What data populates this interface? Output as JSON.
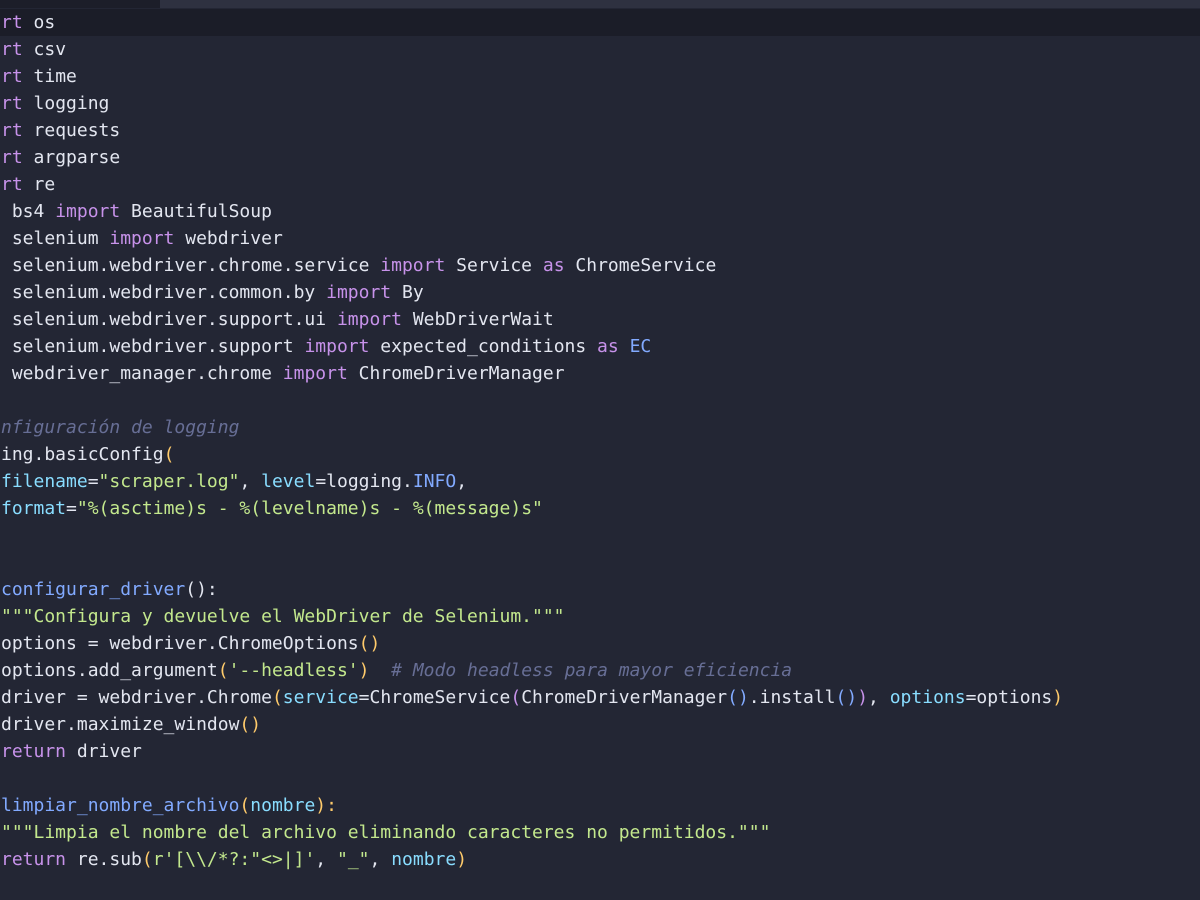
{
  "editor": {
    "colors": {
      "background": "#232634",
      "current_line": "#1b1d28",
      "keyword": "#c792ea",
      "identifier": "#e3e6f0",
      "function": "#82aaff",
      "string": "#c3e88d",
      "comment": "#676e95",
      "parameter": "#89ddff",
      "bracket": "#ffcb6b"
    },
    "lines": [
      {
        "tokens": [
          {
            "t": "rt",
            "c": "kw"
          },
          {
            "t": " os",
            "c": "var"
          }
        ]
      },
      {
        "tokens": [
          {
            "t": "rt",
            "c": "kw"
          },
          {
            "t": " csv",
            "c": "var"
          }
        ]
      },
      {
        "tokens": [
          {
            "t": "rt",
            "c": "kw"
          },
          {
            "t": " time",
            "c": "var"
          }
        ]
      },
      {
        "tokens": [
          {
            "t": "rt",
            "c": "kw"
          },
          {
            "t": " logging",
            "c": "var"
          }
        ]
      },
      {
        "tokens": [
          {
            "t": "rt",
            "c": "kw"
          },
          {
            "t": " requests",
            "c": "var"
          }
        ]
      },
      {
        "tokens": [
          {
            "t": "rt",
            "c": "kw"
          },
          {
            "t": " argparse",
            "c": "var"
          }
        ]
      },
      {
        "tokens": [
          {
            "t": "rt",
            "c": "kw"
          },
          {
            "t": " re",
            "c": "var"
          }
        ]
      },
      {
        "tokens": [
          {
            "t": " bs4 ",
            "c": "var"
          },
          {
            "t": "import",
            "c": "kw"
          },
          {
            "t": " BeautifulSoup",
            "c": "var"
          }
        ]
      },
      {
        "tokens": [
          {
            "t": " selenium ",
            "c": "var"
          },
          {
            "t": "import",
            "c": "kw"
          },
          {
            "t": " webdriver",
            "c": "var"
          }
        ]
      },
      {
        "tokens": [
          {
            "t": " selenium.webdriver.chrome.service ",
            "c": "var"
          },
          {
            "t": "import",
            "c": "kw"
          },
          {
            "t": " Service ",
            "c": "var"
          },
          {
            "t": "as",
            "c": "kw"
          },
          {
            "t": " ChromeService",
            "c": "var"
          }
        ]
      },
      {
        "tokens": [
          {
            "t": " selenium.webdriver.common.by ",
            "c": "var"
          },
          {
            "t": "import",
            "c": "kw"
          },
          {
            "t": " By",
            "c": "var"
          }
        ]
      },
      {
        "tokens": [
          {
            "t": " selenium.webdriver.support.ui ",
            "c": "var"
          },
          {
            "t": "import",
            "c": "kw"
          },
          {
            "t": " WebDriverWait",
            "c": "var"
          }
        ]
      },
      {
        "tokens": [
          {
            "t": " selenium.webdriver.support ",
            "c": "var"
          },
          {
            "t": "import",
            "c": "kw"
          },
          {
            "t": " expected_conditions ",
            "c": "var"
          },
          {
            "t": "as",
            "c": "kw"
          },
          {
            "t": " EC",
            "c": "fn"
          }
        ]
      },
      {
        "tokens": [
          {
            "t": " webdriver_manager.chrome ",
            "c": "var"
          },
          {
            "t": "import",
            "c": "kw"
          },
          {
            "t": " ChromeDriverManager",
            "c": "var"
          }
        ]
      },
      {
        "tokens": []
      },
      {
        "tokens": [
          {
            "t": "nfiguración de logging",
            "c": "cmt"
          }
        ]
      },
      {
        "tokens": [
          {
            "t": "ing.basicConfig",
            "c": "var"
          },
          {
            "t": "(",
            "c": "brk"
          }
        ]
      },
      {
        "tokens": [
          {
            "t": "filename",
            "c": "par"
          },
          {
            "t": "=",
            "c": "op"
          },
          {
            "t": "\"scraper.log\"",
            "c": "str"
          },
          {
            "t": ", ",
            "c": "sym"
          },
          {
            "t": "level",
            "c": "par"
          },
          {
            "t": "=",
            "c": "op"
          },
          {
            "t": "logging.",
            "c": "var"
          },
          {
            "t": "INFO",
            "c": "fn"
          },
          {
            "t": ",",
            "c": "sym"
          }
        ]
      },
      {
        "tokens": [
          {
            "t": "format",
            "c": "par"
          },
          {
            "t": "=",
            "c": "op"
          },
          {
            "t": "\"%(asctime)s - %(levelname)s - %(message)s\"",
            "c": "str"
          }
        ]
      },
      {
        "tokens": []
      },
      {
        "tokens": []
      },
      {
        "tokens": [
          {
            "t": "configurar_driver",
            "c": "fn"
          },
          {
            "t": "():",
            "c": "sym"
          }
        ]
      },
      {
        "tokens": [
          {
            "t": "\"\"\"Configura y devuelve el WebDriver de Selenium.\"\"\"",
            "c": "str"
          }
        ]
      },
      {
        "tokens": [
          {
            "t": "options = webdriver.ChromeOptions",
            "c": "var"
          },
          {
            "t": "()",
            "c": "brk"
          }
        ]
      },
      {
        "tokens": [
          {
            "t": "options.add_argument",
            "c": "var"
          },
          {
            "t": "(",
            "c": "brk"
          },
          {
            "t": "'--headless'",
            "c": "str"
          },
          {
            "t": ")",
            "c": "brk"
          },
          {
            "t": "  ",
            "c": "var"
          },
          {
            "t": "# Modo headless para mayor eficiencia",
            "c": "cmt"
          }
        ]
      },
      {
        "tokens": [
          {
            "t": "driver = webdriver.Chrome",
            "c": "var"
          },
          {
            "t": "(",
            "c": "brk"
          },
          {
            "t": "service",
            "c": "par"
          },
          {
            "t": "=ChromeService",
            "c": "var"
          },
          {
            "t": "(",
            "c": "brk2"
          },
          {
            "t": "ChromeDriverManager",
            "c": "var"
          },
          {
            "t": "()",
            "c": "brk3"
          },
          {
            "t": ".install",
            "c": "var"
          },
          {
            "t": "()",
            "c": "brk3"
          },
          {
            "t": ")",
            "c": "brk2"
          },
          {
            "t": ", ",
            "c": "sym"
          },
          {
            "t": "options",
            "c": "par"
          },
          {
            "t": "=options",
            "c": "var"
          },
          {
            "t": ")",
            "c": "brk"
          }
        ]
      },
      {
        "tokens": [
          {
            "t": "driver.maximize_window",
            "c": "var"
          },
          {
            "t": "()",
            "c": "brk"
          }
        ]
      },
      {
        "tokens": [
          {
            "t": "return",
            "c": "kw"
          },
          {
            "t": " driver",
            "c": "var"
          }
        ]
      },
      {
        "tokens": []
      },
      {
        "tokens": [
          {
            "t": "limpiar_nombre_archivo",
            "c": "fn"
          },
          {
            "t": "(",
            "c": "brk"
          },
          {
            "t": "nombre",
            "c": "par"
          },
          {
            "t": "):",
            "c": "brk"
          }
        ]
      },
      {
        "tokens": [
          {
            "t": "\"\"\"Limpia el nombre del archivo eliminando caracteres no permitidos.\"\"\"",
            "c": "str"
          }
        ]
      },
      {
        "tokens": [
          {
            "t": "return",
            "c": "kw"
          },
          {
            "t": " re.sub",
            "c": "var"
          },
          {
            "t": "(",
            "c": "brk"
          },
          {
            "t": "r'[\\\\/*?:\"<>|]'",
            "c": "str"
          },
          {
            "t": ", ",
            "c": "sym"
          },
          {
            "t": "\"_\"",
            "c": "str"
          },
          {
            "t": ", ",
            "c": "sym"
          },
          {
            "t": "nombre",
            "c": "par"
          },
          {
            "t": ")",
            "c": "brk"
          }
        ]
      }
    ]
  }
}
